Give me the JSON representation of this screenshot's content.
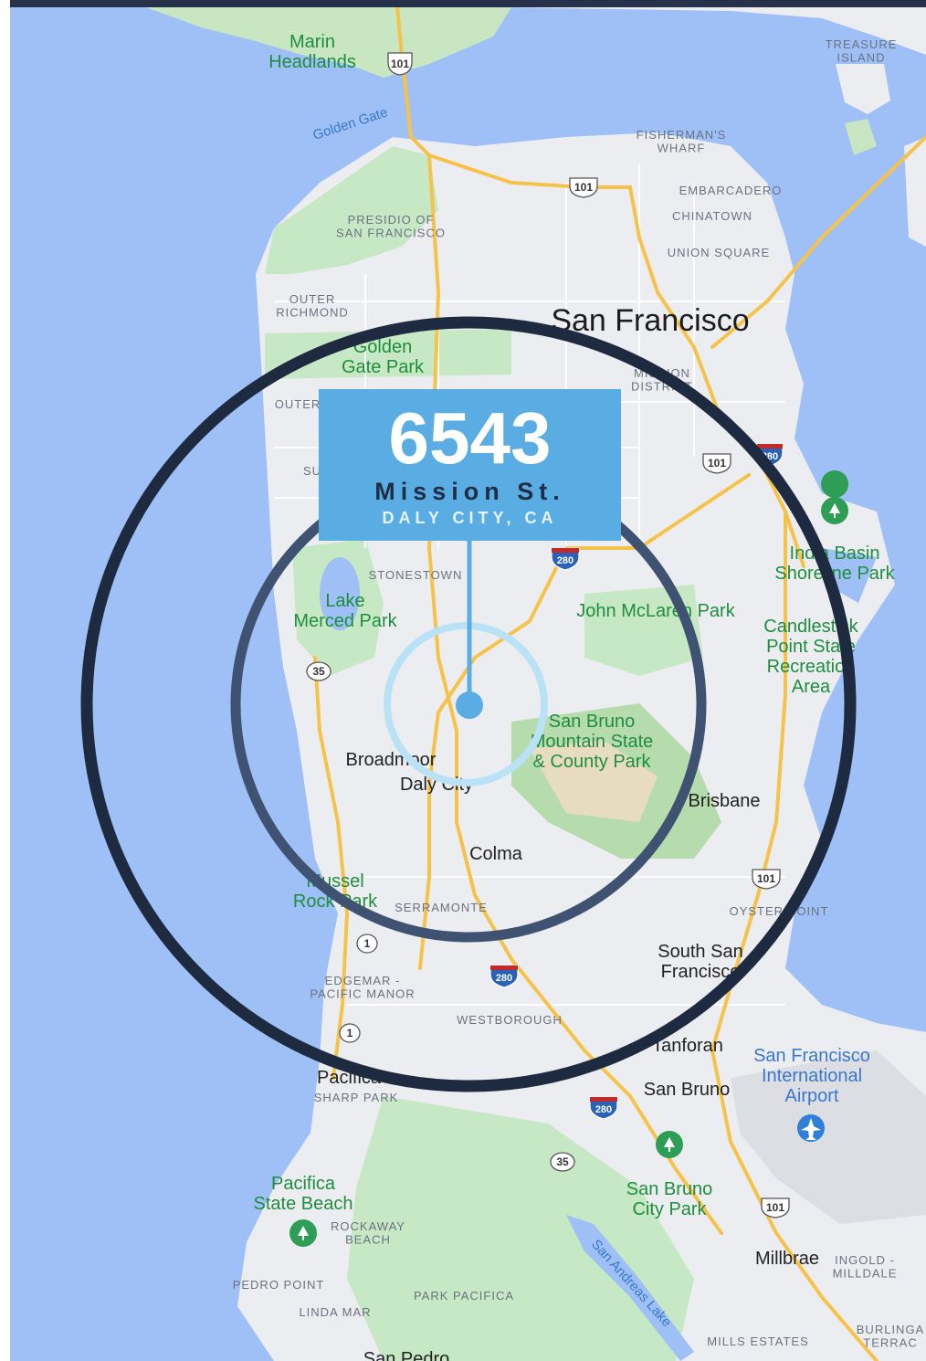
{
  "address": {
    "number": "6543",
    "street": "Mission St.",
    "city": "DALY CITY, CA"
  },
  "colors": {
    "water": "#9ec0f6",
    "land": "#ecedf1",
    "park": "#c7e8c4",
    "highway": "#f6c34a",
    "callout_bg": "#5aade2",
    "outer_ring": "#1e2a40",
    "inner_ring": "#3f5272",
    "focus_ring": "#b9e2f7"
  },
  "map_labels": {
    "marin_headlands": "Marin\nHeadlands",
    "golden_gate": "Golden Gate",
    "treasure_island": "TREASURE\nISLAND",
    "fishermans_wharf": "FISHERMAN'S\nWHARF",
    "embarcadero": "EMBARCADERO",
    "chinatown": "CHINATOWN",
    "presidio": "PRESIDIO OF\nSAN FRANCISCO",
    "union_square": "UNION SQUARE",
    "outer_richmond": "OUTER\nRICHMOND",
    "san_francisco": "San Francisco",
    "golden_gate_park": "Golden\nGate Park",
    "mission_district": "MISSION\nDISTRICT",
    "outer_sunset": "OUTER",
    "sunset": "SU",
    "india_basin": "India Basin\nShoreline Park",
    "stonestown": "STONESTOWN",
    "lake_merced": "Lake\nMerced Park",
    "john_mclaren": "John McLaren Park",
    "candlestick": "Candlestick\nPoint State\nRecreation\nArea",
    "san_bruno_mountain": "San Bruno\nMountain State\n& County Park",
    "broadmoor": "Broadmoor",
    "daly_city": "Daly City",
    "brisbane": "Brisbane",
    "colma": "Colma",
    "mussel_rock": "Mussel\nRock Park",
    "serramonte": "SERRAMONTE",
    "oyster_point": "OYSTER POINT",
    "south_sf": "South San\nFrancisco",
    "edgemar": "EDGEMAR -\nPACIFIC MANOR",
    "westborough": "WESTBOROUGH",
    "tanforan": "Tanforan",
    "sfo": "San Francisco\nInternational\nAirport",
    "pacifica": "Pacifica",
    "sharp_park": "SHARP PARK",
    "san_bruno": "San Bruno",
    "pacifica_state_beach": "Pacifica\nState Beach",
    "san_bruno_city_park": "San Bruno\nCity Park",
    "rockaway_beach": "ROCKAWAY\nBEACH",
    "millbrae": "Millbrae",
    "ingold_milldale": "INGOLD -\nMILLDALE",
    "san_andreas_lake": "San Andreas Lake",
    "pedro_point": "PEDRO POINT",
    "park_pacifica": "PARK PACIFICA",
    "linda_mar": "LINDA MAR",
    "mills_estates": "MILLS ESTATES",
    "burlingame_terrace": "BURLINGA\nTERRAC",
    "san_pedro": "San Pedro"
  },
  "route_shields": {
    "us101": "101",
    "i280": "280",
    "ca35": "35",
    "ca1": "1"
  }
}
